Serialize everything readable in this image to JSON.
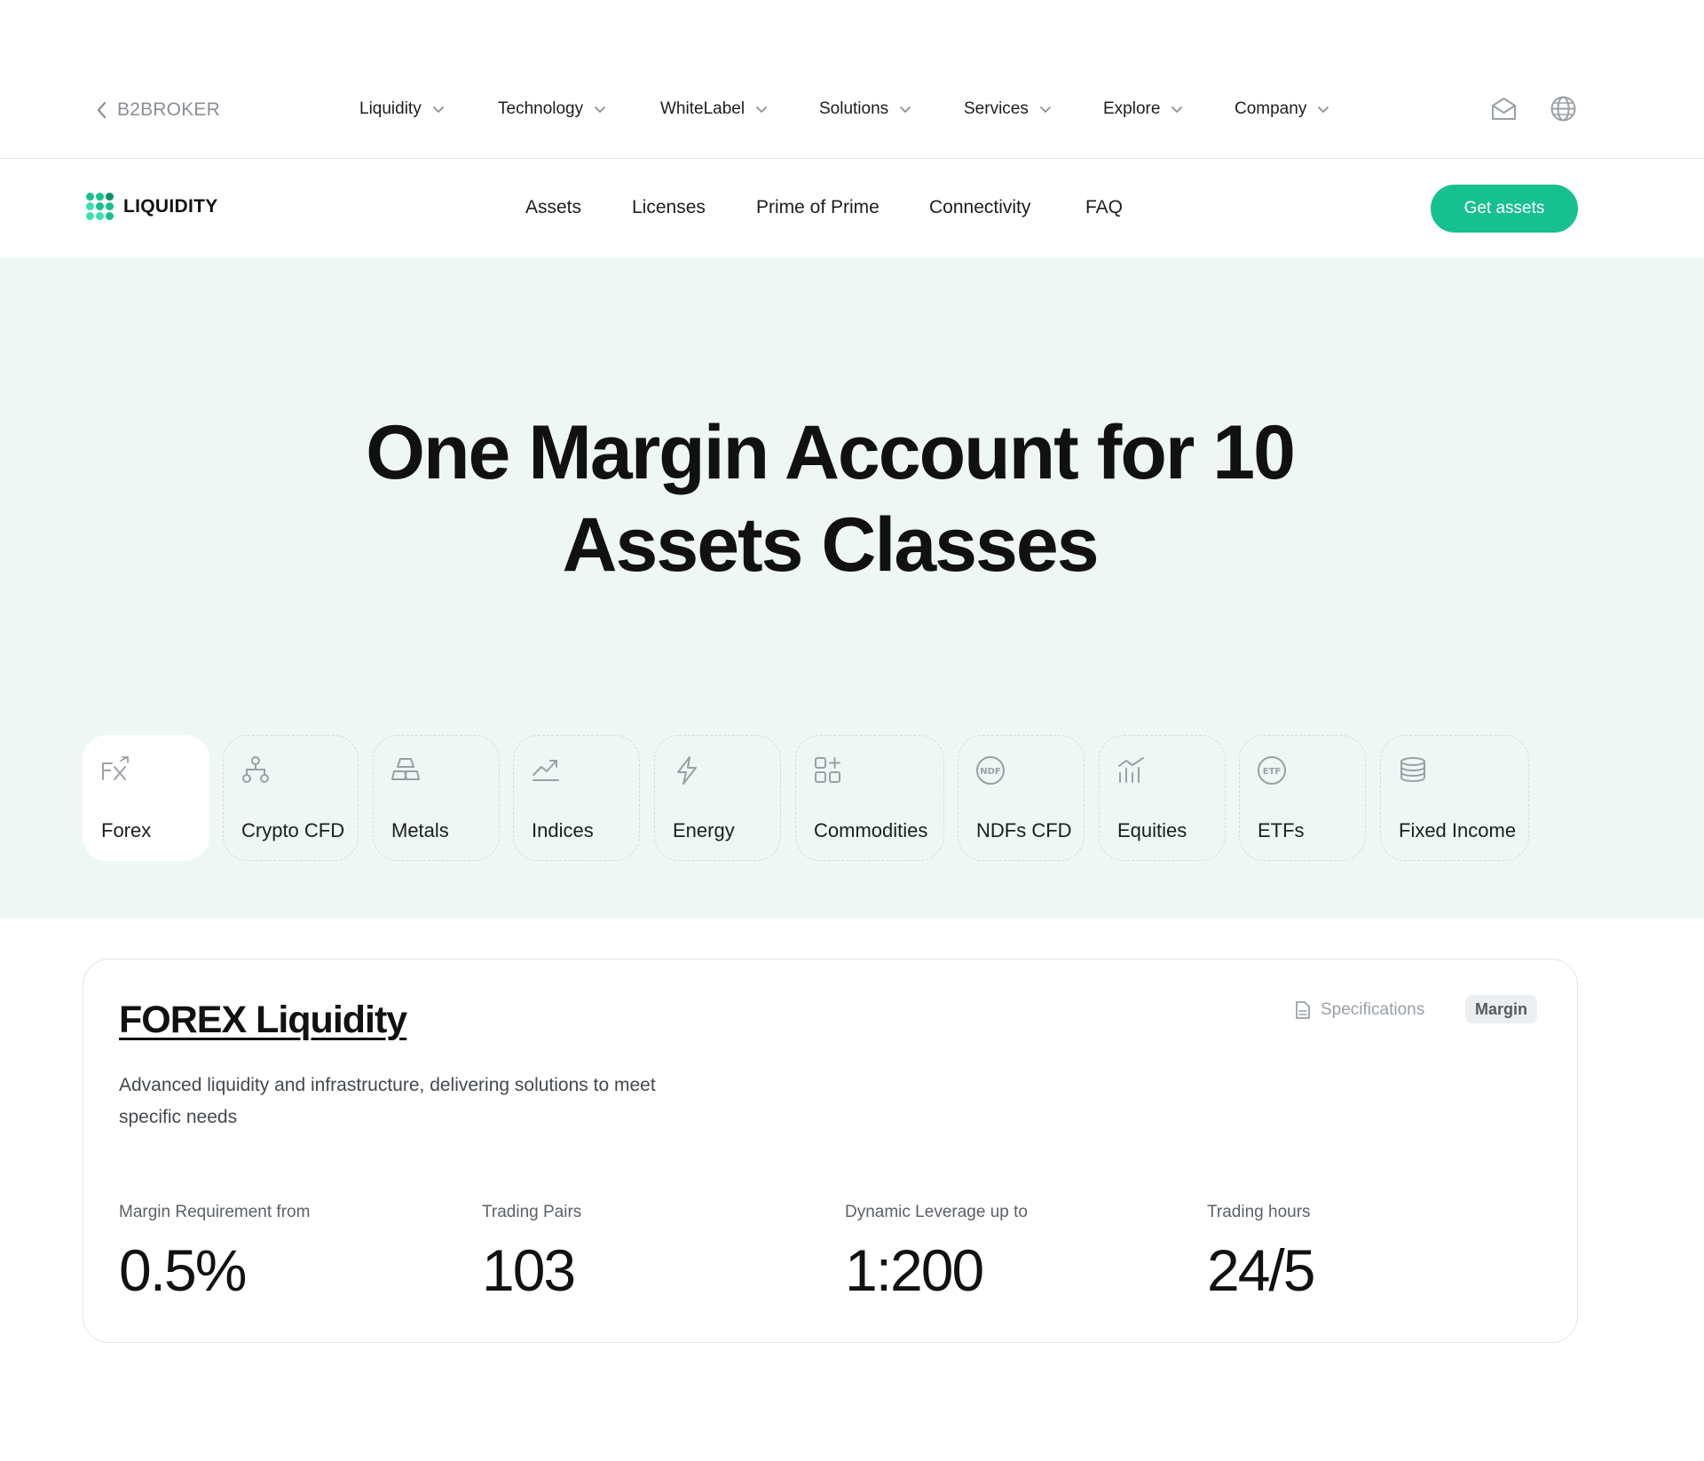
{
  "topbar": {
    "back_label": "B2BROKER",
    "nav": [
      {
        "label": "Liquidity"
      },
      {
        "label": "Technology"
      },
      {
        "label": "WhiteLabel"
      },
      {
        "label": "Solutions"
      },
      {
        "label": "Services"
      },
      {
        "label": "Explore"
      },
      {
        "label": "Company"
      }
    ],
    "icons": [
      "mail-icon",
      "globe-icon"
    ]
  },
  "subbar": {
    "logo_text": "LIQUIDITY",
    "nav": [
      {
        "label": "Assets"
      },
      {
        "label": "Licenses"
      },
      {
        "label": "Prime of Prime"
      },
      {
        "label": "Connectivity"
      },
      {
        "label": "FAQ"
      }
    ],
    "cta_label": "Get assets"
  },
  "hero": {
    "title_line1": "One Margin Account for 10",
    "title_line2": "Assets Classes",
    "tabs": [
      {
        "label": "Forex",
        "icon": "fx-icon",
        "active": true
      },
      {
        "label": "Crypto CFD",
        "icon": "network-icon",
        "active": false
      },
      {
        "label": "Metals",
        "icon": "gold-bars-icon",
        "active": false
      },
      {
        "label": "Indices",
        "icon": "trend-up-icon",
        "active": false
      },
      {
        "label": "Energy",
        "icon": "lightning-icon",
        "active": false
      },
      {
        "label": "Commodities",
        "icon": "grid-plus-icon",
        "active": false
      },
      {
        "label": "NDFs CFD",
        "icon": "ndf-icon",
        "active": false
      },
      {
        "label": "Equities",
        "icon": "chart-bars-icon",
        "active": false
      },
      {
        "label": "ETFs",
        "icon": "etf-icon",
        "active": false
      },
      {
        "label": "Fixed Income",
        "icon": "coins-stack-icon",
        "active": false
      }
    ]
  },
  "card": {
    "title": "FOREX Liquidity",
    "description": "Advanced liquidity and infrastructure, delivering solutions to meet specific needs",
    "specifications_label": "Specifications",
    "badge_label": "Margin",
    "stats": [
      {
        "label": "Margin Requirement from",
        "value": "0.5%"
      },
      {
        "label": "Trading Pairs",
        "value": "103"
      },
      {
        "label": "Dynamic Leverage up to",
        "value": "1:200"
      },
      {
        "label": "Trading hours",
        "value": "24/5"
      }
    ]
  },
  "colors": {
    "accent": "#17c08f",
    "hero_background": "#eef7f4",
    "logo_dots": [
      "#0a8f6a",
      "#17c08f",
      "#3be0b0"
    ]
  }
}
